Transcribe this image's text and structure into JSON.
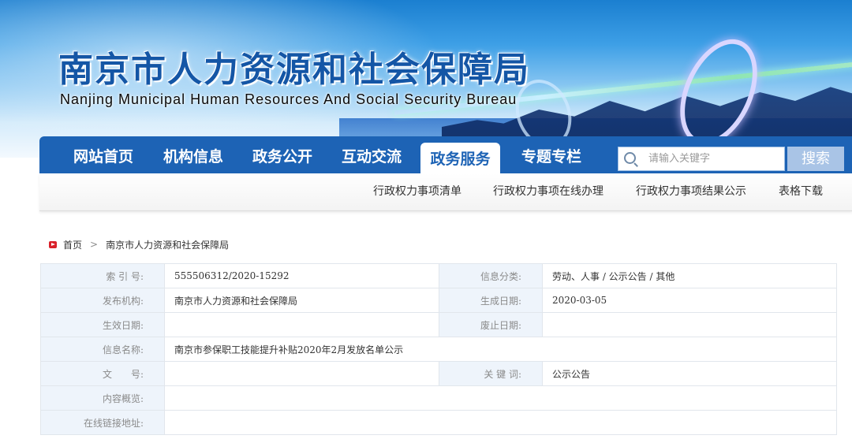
{
  "banner": {
    "title_cn": "南京市人力资源和社会保障局",
    "title_en": "Nanjing Municipal Human Resources And Social Security Bureau"
  },
  "nav": {
    "items": [
      {
        "label": "网站首页"
      },
      {
        "label": "机构信息"
      },
      {
        "label": "政务公开"
      },
      {
        "label": "互动交流"
      },
      {
        "label": "政务服务",
        "active": true
      },
      {
        "label": "专题专栏"
      }
    ],
    "search_placeholder": "请输入关键字",
    "search_button": "搜索"
  },
  "subnav": {
    "items": [
      {
        "label": "行政权力事项清单"
      },
      {
        "label": "行政权力事项在线办理"
      },
      {
        "label": "行政权力事项结果公示"
      },
      {
        "label": "表格下载"
      }
    ]
  },
  "breadcrumb": {
    "home": "首页",
    "separator": ">",
    "current": "南京市人力资源和社会保障局"
  },
  "info_table": {
    "index_label": "索 引 号:",
    "index_value": "555506312/2020-15292",
    "category_label": "信息分类:",
    "category_value": "劳动、人事 / 公示公告 / 其他",
    "publisher_label": "发布机构:",
    "publisher_value": "南京市人力资源和社会保障局",
    "created_label": "生成日期:",
    "created_value": "2020-03-05",
    "effective_label": "生效日期:",
    "effective_value": "",
    "abolished_label": "废止日期:",
    "abolished_value": "",
    "name_label": "信息名称:",
    "name_value": "南京市参保职工技能提升补贴2020年2月发放名单公示",
    "doc_no_label": "文　　号:",
    "doc_no_value": "",
    "keywords_label": "关 键 词:",
    "keywords_value": "公示公告",
    "summary_label": "内容概览:",
    "summary_value": "",
    "link_label": "在线链接地址:",
    "link_value": ""
  },
  "colors": {
    "nav_blue": "#1d63b5",
    "label_bg": "#eef4fb",
    "home_icon_red": "#d9202a"
  }
}
